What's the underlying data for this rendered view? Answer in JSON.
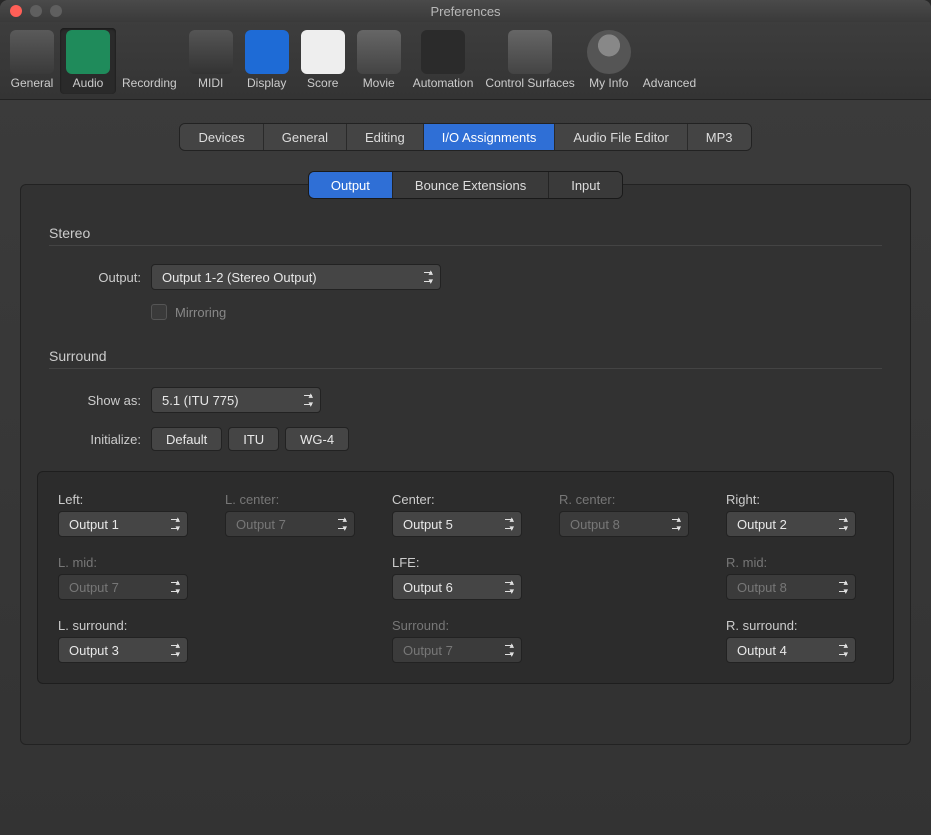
{
  "window": {
    "title": "Preferences"
  },
  "toolbar": [
    {
      "id": "general",
      "label": "General"
    },
    {
      "id": "audio",
      "label": "Audio"
    },
    {
      "id": "recording",
      "label": "Recording"
    },
    {
      "id": "midi",
      "label": "MIDI"
    },
    {
      "id": "display",
      "label": "Display"
    },
    {
      "id": "score",
      "label": "Score"
    },
    {
      "id": "movie",
      "label": "Movie"
    },
    {
      "id": "automation",
      "label": "Automation"
    },
    {
      "id": "controlsurfaces",
      "label": "Control Surfaces"
    },
    {
      "id": "myinfo",
      "label": "My Info"
    },
    {
      "id": "advanced",
      "label": "Advanced"
    }
  ],
  "primary_tabs": [
    "Devices",
    "General",
    "Editing",
    "I/O Assignments",
    "Audio File Editor",
    "MP3"
  ],
  "primary_selected": "I/O Assignments",
  "secondary_tabs": [
    "Output",
    "Bounce Extensions",
    "Input"
  ],
  "secondary_selected": "Output",
  "stereo": {
    "heading": "Stereo",
    "output_label": "Output:",
    "output_value": "Output 1-2 (Stereo Output)",
    "mirroring_label": "Mirroring",
    "mirroring_checked": false
  },
  "surround": {
    "heading": "Surround",
    "show_as_label": "Show as:",
    "show_as_value": "5.1 (ITU 775)",
    "initialize_label": "Initialize:",
    "init_buttons": [
      "Default",
      "ITU",
      "WG-4"
    ],
    "grid": [
      [
        {
          "label": "Left:",
          "value": "Output 1",
          "enabled": true
        },
        {
          "label": "L. center:",
          "value": "Output 7",
          "enabled": false
        },
        {
          "label": "Center:",
          "value": "Output 5",
          "enabled": true
        },
        {
          "label": "R. center:",
          "value": "Output 8",
          "enabled": false
        },
        {
          "label": "Right:",
          "value": "Output 2",
          "enabled": true
        }
      ],
      [
        {
          "label": "L. mid:",
          "value": "Output 7",
          "enabled": false
        },
        null,
        {
          "label": "LFE:",
          "value": "Output 6",
          "enabled": true
        },
        null,
        {
          "label": "R. mid:",
          "value": "Output 8",
          "enabled": false
        }
      ],
      [
        {
          "label": "L. surround:",
          "value": "Output 3",
          "enabled": true
        },
        null,
        {
          "label": "Surround:",
          "value": "Output 7",
          "enabled": false
        },
        null,
        {
          "label": "R. surround:",
          "value": "Output 4",
          "enabled": true
        }
      ]
    ]
  }
}
